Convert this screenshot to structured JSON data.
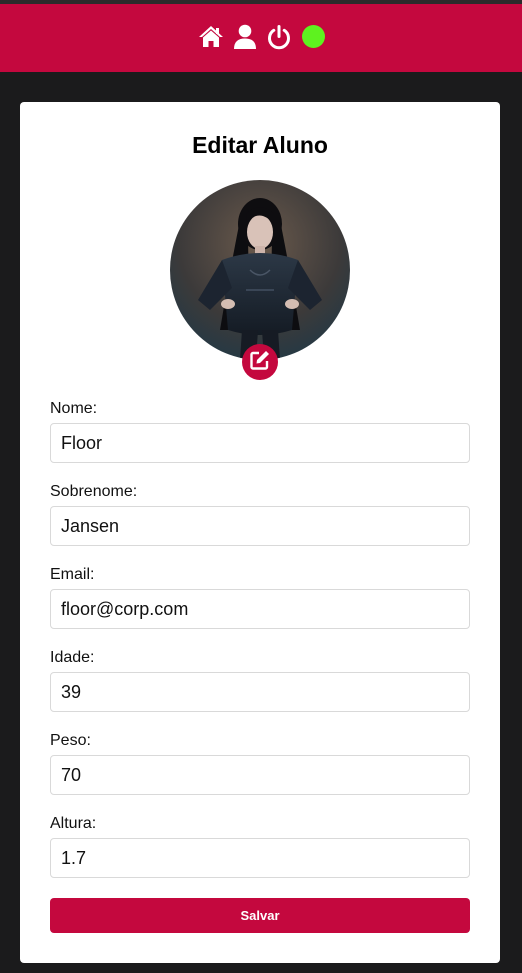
{
  "header": {
    "bg_color": "#c4083e",
    "icons": [
      "home-icon",
      "user-icon",
      "power-icon"
    ],
    "status_color": "#5ef21f"
  },
  "form": {
    "title": "Editar Aluno",
    "photo_alt": "Foto do aluno",
    "fields": [
      {
        "label": "Nome:",
        "value": "Floor"
      },
      {
        "label": "Sobrenome:",
        "value": "Jansen"
      },
      {
        "label": "Email:",
        "value": "floor@corp.com"
      },
      {
        "label": "Idade:",
        "value": "39"
      },
      {
        "label": "Peso:",
        "value": "70"
      },
      {
        "label": "Altura:",
        "value": "1.7"
      }
    ],
    "submit_label": "Salvar"
  }
}
